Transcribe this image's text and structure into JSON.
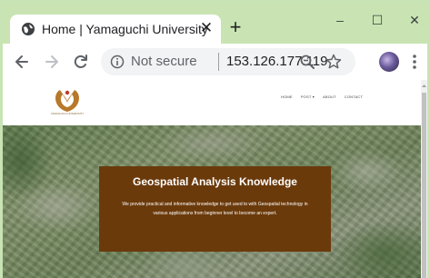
{
  "browser": {
    "tab_title": "Home | Yamaguchi University",
    "tab_close_glyph": "✕",
    "new_tab_glyph": "+",
    "window_minimize_glyph": "–",
    "window_maximize_glyph": "☐",
    "window_close_glyph": "✕",
    "security_label": "Not secure",
    "url": "153.126.177.119",
    "frame_color": "#c9e4b2",
    "icons": {
      "favicon": "globe-icon",
      "back": "back-arrow-icon",
      "forward": "forward-arrow-icon",
      "reload": "reload-icon",
      "info": "info-icon",
      "zoom": "zoom-icon",
      "bookmark": "star-icon",
      "profile": "avatar",
      "menu": "more-vert-icon"
    }
  },
  "site": {
    "logo_caption": "YAMAGUCHI UNIVERSITY",
    "nav": [
      {
        "label": "HOME"
      },
      {
        "label": "POST ▾"
      },
      {
        "label": "ABOUT"
      },
      {
        "label": "CONTACT"
      }
    ],
    "hero": {
      "title": "Geospatial Analysis Knowledge",
      "description": "We provide practical and informative knowledge to get used to with Geospatial technology in various applications from beginner level to become an expert.",
      "box_color": "#6b3a0b"
    }
  }
}
